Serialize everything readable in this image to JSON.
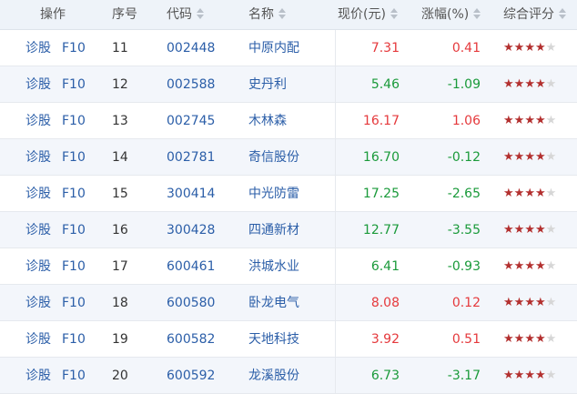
{
  "header": {
    "op": "操作",
    "seq": "序号",
    "code": "代码",
    "name": "名称",
    "price": "现价(元)",
    "change": "涨幅(%)",
    "rating": "综合评分"
  },
  "row_actions": {
    "diagnose": "诊股",
    "f10": "F10"
  },
  "colors": {
    "up": "#e5393c",
    "down": "#1a9a3a",
    "link": "#2b5ea8",
    "star": "#b3302f"
  },
  "rows": [
    {
      "seq": "11",
      "code": "002448",
      "name": "中原内配",
      "price": "7.31",
      "change": "0.41",
      "trend": "up",
      "stars": 4
    },
    {
      "seq": "12",
      "code": "002588",
      "name": "史丹利",
      "price": "5.46",
      "change": "-1.09",
      "trend": "down",
      "stars": 4
    },
    {
      "seq": "13",
      "code": "002745",
      "name": "木林森",
      "price": "16.17",
      "change": "1.06",
      "trend": "up",
      "stars": 4
    },
    {
      "seq": "14",
      "code": "002781",
      "name": "奇信股份",
      "price": "16.70",
      "change": "-0.12",
      "trend": "down",
      "stars": 4
    },
    {
      "seq": "15",
      "code": "300414",
      "name": "中光防雷",
      "price": "17.25",
      "change": "-2.65",
      "trend": "down",
      "stars": 4
    },
    {
      "seq": "16",
      "code": "300428",
      "name": "四通新材",
      "price": "12.77",
      "change": "-3.55",
      "trend": "down",
      "stars": 4
    },
    {
      "seq": "17",
      "code": "600461",
      "name": "洪城水业",
      "price": "6.41",
      "change": "-0.93",
      "trend": "down",
      "stars": 4
    },
    {
      "seq": "18",
      "code": "600580",
      "name": "卧龙电气",
      "price": "8.08",
      "change": "0.12",
      "trend": "up",
      "stars": 4
    },
    {
      "seq": "19",
      "code": "600582",
      "name": "天地科技",
      "price": "3.92",
      "change": "0.51",
      "trend": "up",
      "stars": 4
    },
    {
      "seq": "20",
      "code": "600592",
      "name": "龙溪股份",
      "price": "6.73",
      "change": "-3.17",
      "trend": "down",
      "stars": 4
    }
  ]
}
